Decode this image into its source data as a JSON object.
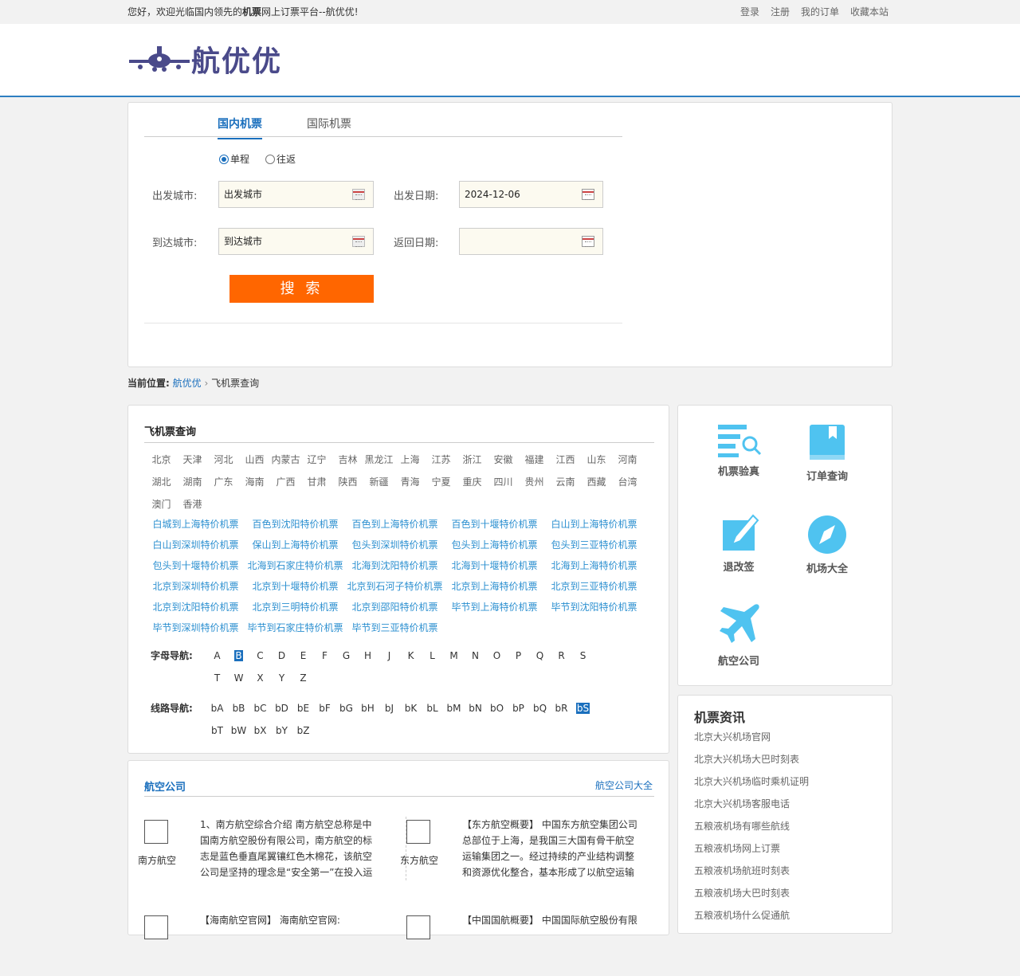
{
  "topbar": {
    "welcome_pre": "您好，欢迎光临国内领先的",
    "welcome_bold": "机票",
    "welcome_post": "网上订票平台--航优优!",
    "links": [
      "登录",
      "注册",
      "我的订单",
      "收藏本站"
    ]
  },
  "header": {
    "logo_text": "航优优"
  },
  "search": {
    "tabs": [
      "国内机票",
      "国际机票"
    ],
    "trip_types": [
      "单程",
      "往返"
    ],
    "depart_city_label": "出发城市:",
    "depart_city_value": "出发城市",
    "arrive_city_label": "到达城市:",
    "arrive_city_value": "到达城市",
    "depart_date_label": "出发日期:",
    "depart_date_value": "2024-12-06",
    "return_date_label": "返回日期:",
    "return_date_value": "",
    "search_button": "搜 索"
  },
  "breadcrumb": {
    "label": "当前位置:",
    "home": "航优优",
    "sep": "›",
    "current": "飞机票查询"
  },
  "query": {
    "title": "飞机票查询",
    "provinces": [
      "北京",
      "天津",
      "河北",
      "山西",
      "内蒙古",
      "辽宁",
      "吉林",
      "黑龙江",
      "上海",
      "江苏",
      "浙江",
      "安徽",
      "福建",
      "江西",
      "山东",
      "河南",
      "湖北",
      "湖南",
      "广东",
      "海南",
      "广西",
      "甘肃",
      "陕西",
      "新疆",
      "青海",
      "宁夏",
      "重庆",
      "四川",
      "贵州",
      "云南",
      "西藏",
      "台湾",
      "澳门",
      "香港"
    ],
    "routes": [
      "白城到上海特价机票",
      "百色到沈阳特价机票",
      "百色到上海特价机票",
      "百色到十堰特价机票",
      "白山到上海特价机票",
      "白山到深圳特价机票",
      "保山到上海特价机票",
      "包头到深圳特价机票",
      "包头到上海特价机票",
      "包头到三亚特价机票",
      "包头到十堰特价机票",
      "北海到石家庄特价机票",
      "北海到沈阳特价机票",
      "北海到十堰特价机票",
      "北海到上海特价机票",
      "北京到深圳特价机票",
      "北京到十堰特价机票",
      "北京到石河子特价机票",
      "北京到上海特价机票",
      "北京到三亚特价机票",
      "北京到沈阳特价机票",
      "北京到三明特价机票",
      "北京到邵阳特价机票",
      "毕节到上海特价机票",
      "毕节到沈阳特价机票",
      "毕节到深圳特价机票",
      "毕节到石家庄特价机票",
      "毕节到三亚特价机票"
    ],
    "letter_nav_label": "字母导航:",
    "letters": [
      "A",
      "B",
      "C",
      "D",
      "E",
      "F",
      "G",
      "H",
      "J",
      "K",
      "L",
      "M",
      "N",
      "O",
      "P",
      "Q",
      "R",
      "S",
      "T",
      "W",
      "X",
      "Y",
      "Z"
    ],
    "route_nav_label": "线路导航:",
    "route_letters": [
      "bA",
      "bB",
      "bC",
      "bD",
      "bE",
      "bF",
      "bG",
      "bH",
      "bJ",
      "bK",
      "bL",
      "bM",
      "bN",
      "bO",
      "bP",
      "bQ",
      "bR",
      "bS",
      "bT",
      "bW",
      "bX",
      "bY",
      "bZ"
    ]
  },
  "services": [
    {
      "label": "机票验真",
      "icon": "ticket-verify-icon"
    },
    {
      "label": "订单查询",
      "icon": "book-icon"
    },
    {
      "label": "退改签",
      "icon": "edit-icon"
    },
    {
      "label": "机场大全",
      "icon": "compass-icon"
    },
    {
      "label": "航空公司",
      "icon": "airplane-icon"
    }
  ],
  "news": {
    "title": "机票资讯",
    "items": [
      "北京大兴机场官网",
      "北京大兴机场大巴时刻表",
      "北京大兴机场临时乘机证明",
      "北京大兴机场客服电话",
      "五粮液机场有哪些航线",
      "五粮液机场网上订票",
      "五粮液机场航班时刻表",
      "五粮液机场大巴时刻表",
      "五粮液机场什么促通航"
    ]
  },
  "airlines": {
    "title": "航空公司",
    "more": "航空公司大全",
    "cards": [
      {
        "name": "南方航空",
        "desc": "1、南方航空综合介绍 南方航空总称是中国南方航空股份有限公司，南方航空的标志是蓝色垂直尾翼镶红色木棉花，该航空公司是坚持的理念是“安全第一”在投入运"
      },
      {
        "name": "东方航空",
        "desc": "【东方航空概要】 中国东方航空集团公司总部位于上海，是我国三大国有骨干航空运输集团之一。经过持续的产业结构调整和资源优化整合，基本形成了以航空运输"
      },
      {
        "name": "",
        "desc": "【海南航空官网】 海南航空官网:"
      },
      {
        "name": "",
        "desc": "【中国国航概要】 中国国际航空股份有限"
      }
    ]
  },
  "colors": {
    "accent": "#1a6fbd",
    "link": "#2b8fd0",
    "button": "#ff6600",
    "icon": "#4fc3f0"
  }
}
